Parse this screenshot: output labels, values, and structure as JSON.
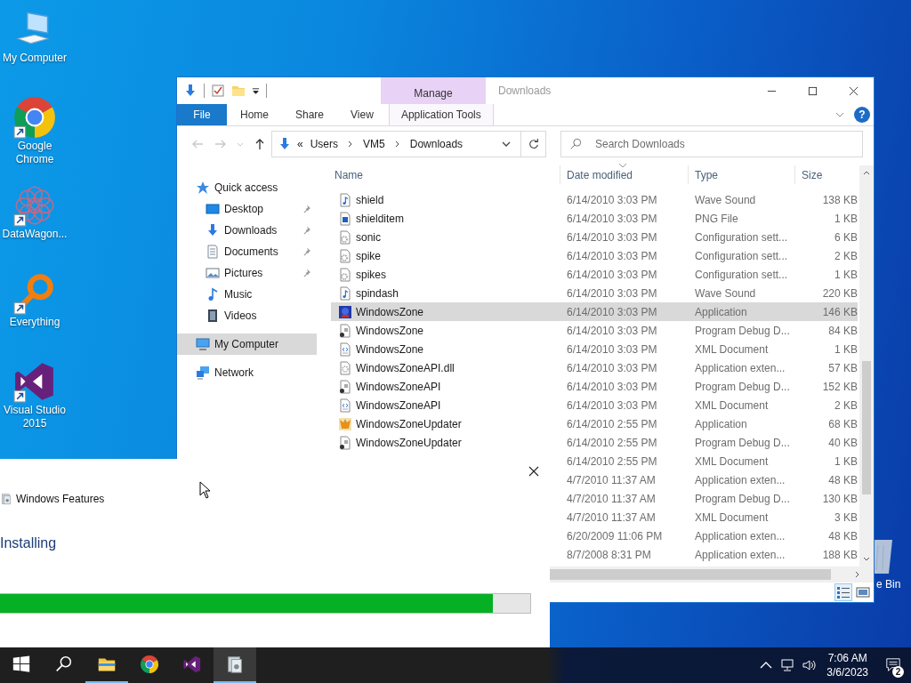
{
  "desktop": {
    "icons": [
      {
        "kind": "computer",
        "label": "My Computer",
        "shortcut": false
      },
      {
        "kind": "chrome",
        "label": "Google Chrome",
        "shortcut": true
      },
      {
        "kind": "lattice",
        "label": "DataWagon...",
        "shortcut": true
      },
      {
        "kind": "magnifier",
        "label": "Everything",
        "shortcut": true
      },
      {
        "kind": "studio",
        "label": "Visual Studio 2015",
        "shortcut": true
      }
    ],
    "recycle_bin": {
      "label": "e Bin"
    }
  },
  "explorer": {
    "title": "Downloads",
    "contextual_group": "Manage",
    "help": "?",
    "ribbon_tabs": [
      {
        "label": "File",
        "kind": "file",
        "selected": false
      },
      {
        "label": "Home",
        "kind": "plain",
        "selected": false
      },
      {
        "label": "Share",
        "kind": "plain",
        "selected": false
      },
      {
        "label": "View",
        "kind": "plain",
        "selected": false
      },
      {
        "label": "Application Tools",
        "kind": "contextual",
        "selected": false
      }
    ],
    "nav_buttons": [
      {
        "kind": "back",
        "disabled": true
      },
      {
        "kind": "forward",
        "disabled": true
      },
      {
        "kind": "recent",
        "disabled": true
      },
      {
        "kind": "up",
        "disabled": false
      }
    ],
    "address": {
      "overflow": "«",
      "crumbs": [
        "Users",
        "VM5",
        "Downloads"
      ]
    },
    "search": {
      "placeholder": "Search Downloads"
    },
    "nav_pane": [
      {
        "label": "Quick access",
        "kind": "star",
        "selected": false,
        "children": [
          {
            "label": "Desktop",
            "kind": "desktop",
            "pinned": true,
            "selected": false
          },
          {
            "label": "Downloads",
            "kind": "download",
            "pinned": true,
            "selected": false
          },
          {
            "label": "Documents",
            "kind": "documents",
            "pinned": true,
            "selected": false
          },
          {
            "label": "Pictures",
            "kind": "pictures",
            "pinned": true,
            "selected": false
          },
          {
            "label": "Music",
            "kind": "music",
            "pinned": false,
            "selected": false
          },
          {
            "label": "Videos",
            "kind": "videos",
            "pinned": false,
            "selected": false
          }
        ]
      },
      {
        "label": "My Computer",
        "kind": "computer",
        "selected": true
      },
      {
        "label": "Network",
        "kind": "network",
        "selected": false
      }
    ],
    "columns": [
      {
        "label": "Name",
        "sorted": false
      },
      {
        "label": "Date modified",
        "sorted": true
      },
      {
        "label": "Type",
        "sorted": false
      },
      {
        "label": "Size",
        "sorted": false
      }
    ],
    "rows": [
      {
        "name": "shield",
        "kind": "audio",
        "date": "6/14/2010 3:03 PM",
        "type": "Wave Sound",
        "size": "138 KB",
        "selected": false
      },
      {
        "name": "shielditem",
        "kind": "image",
        "date": "6/14/2010 3:03 PM",
        "type": "PNG File",
        "size": "1 KB",
        "selected": false
      },
      {
        "name": "sonic",
        "kind": "config",
        "date": "6/14/2010 3:03 PM",
        "type": "Configuration sett...",
        "size": "6 KB",
        "selected": false
      },
      {
        "name": "spike",
        "kind": "config",
        "date": "6/14/2010 3:03 PM",
        "type": "Configuration sett...",
        "size": "2 KB",
        "selected": false
      },
      {
        "name": "spikes",
        "kind": "config",
        "date": "6/14/2010 3:03 PM",
        "type": "Configuration sett...",
        "size": "1 KB",
        "selected": false
      },
      {
        "name": "spindash",
        "kind": "audio",
        "date": "6/14/2010 3:03 PM",
        "type": "Wave Sound",
        "size": "220 KB",
        "selected": false
      },
      {
        "name": "WindowsZone",
        "kind": "app",
        "date": "6/14/2010 3:03 PM",
        "type": "Application",
        "size": "146 KB",
        "selected": true
      },
      {
        "name": "WindowsZone",
        "kind": "pdb",
        "date": "6/14/2010 3:03 PM",
        "type": "Program Debug D...",
        "size": "84 KB",
        "selected": false
      },
      {
        "name": "WindowsZone",
        "kind": "xml",
        "date": "6/14/2010 3:03 PM",
        "type": "XML Document",
        "size": "1 KB",
        "selected": false
      },
      {
        "name": "WindowsZoneAPI.dll",
        "kind": "dll",
        "date": "6/14/2010 3:03 PM",
        "type": "Application exten...",
        "size": "57 KB",
        "selected": false
      },
      {
        "name": "WindowsZoneAPI",
        "kind": "pdb",
        "date": "6/14/2010 3:03 PM",
        "type": "Program Debug D...",
        "size": "152 KB",
        "selected": false
      },
      {
        "name": "WindowsZoneAPI",
        "kind": "xml",
        "date": "6/14/2010 3:03 PM",
        "type": "XML Document",
        "size": "2 KB",
        "selected": false
      },
      {
        "name": "WindowsZoneUpdater",
        "kind": "updater",
        "date": "6/14/2010 2:55 PM",
        "type": "Application",
        "size": "68 KB",
        "selected": false
      },
      {
        "name": "WindowsZoneUpdater",
        "kind": "pdb",
        "date": "6/14/2010 2:55 PM",
        "type": "Program Debug D...",
        "size": "40 KB",
        "selected": false
      },
      {
        "date": "6/14/2010 2:55 PM",
        "type": "XML Document",
        "size": "1 KB",
        "selected": false
      },
      {
        "date": "4/7/2010 11:37 AM",
        "type": "Application exten...",
        "size": "48 KB",
        "selected": false
      },
      {
        "date": "4/7/2010 11:37 AM",
        "type": "Program Debug D...",
        "size": "130 KB",
        "selected": false
      },
      {
        "date": "4/7/2010 11:37 AM",
        "type": "XML Document",
        "size": "3 KB",
        "selected": false
      },
      {
        "date": "6/20/2009 11:06 PM",
        "type": "Application exten...",
        "size": "48 KB",
        "selected": false
      },
      {
        "date": "8/7/2008 8:31 PM",
        "type": "Application exten...",
        "size": "188 KB",
        "selected": false
      }
    ],
    "views": [
      {
        "kind": "details",
        "selected": true
      },
      {
        "kind": "large",
        "selected": false
      }
    ]
  },
  "dialog": {
    "title": "Windows Features",
    "status": "Installing",
    "progress": {
      "level": 0.93
    }
  },
  "taskbar": {
    "apps": [
      {
        "kind": "explorer",
        "running": true,
        "active": false
      },
      {
        "kind": "chrome",
        "running": false,
        "active": false
      },
      {
        "kind": "studio",
        "running": false,
        "active": false
      },
      {
        "kind": "features",
        "running": true,
        "active": true
      }
    ],
    "time": "7:06 AM",
    "date": "3/6/2023",
    "notifications": "2"
  }
}
